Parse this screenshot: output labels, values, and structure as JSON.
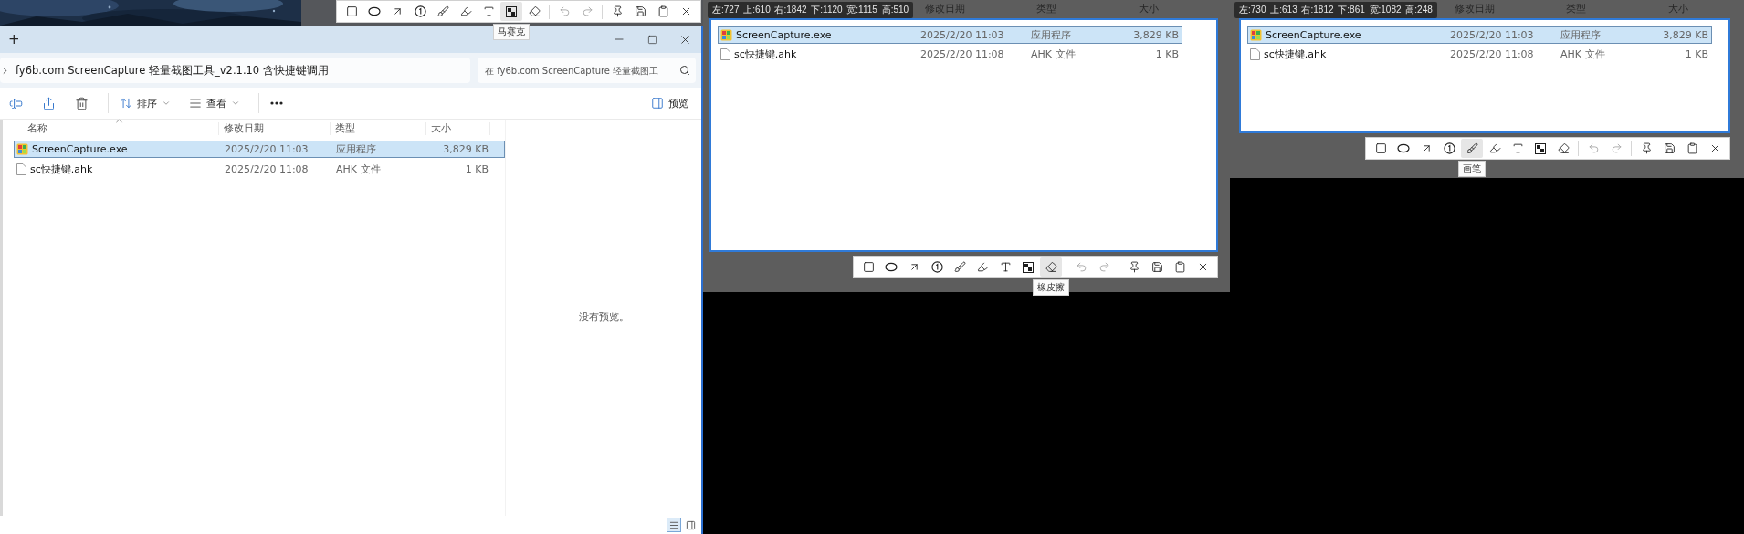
{
  "screen_toolbar": {
    "tooltip": "马赛克",
    "groups": [
      {
        "tools": [
          {
            "kind": "rectangle",
            "hovered": false,
            "disabled": false
          },
          {
            "kind": "ellipse",
            "hovered": false,
            "disabled": false
          },
          {
            "kind": "arrow",
            "hovered": false,
            "disabled": false
          },
          {
            "kind": "number",
            "hovered": false,
            "disabled": false
          },
          {
            "kind": "pen",
            "hovered": false,
            "disabled": false
          },
          {
            "kind": "highlighter",
            "hovered": false,
            "disabled": false
          },
          {
            "kind": "text",
            "hovered": false,
            "disabled": false
          },
          {
            "kind": "mosaic",
            "hovered": true,
            "disabled": false
          },
          {
            "kind": "eraser",
            "hovered": false,
            "disabled": false
          }
        ]
      },
      {
        "tools": [
          {
            "kind": "undo",
            "hovered": false,
            "disabled": true
          },
          {
            "kind": "redo",
            "hovered": false,
            "disabled": true
          }
        ]
      },
      {
        "tools": [
          {
            "kind": "pin",
            "hovered": false,
            "disabled": false
          },
          {
            "kind": "save",
            "hovered": false,
            "disabled": false
          },
          {
            "kind": "copy",
            "hovered": false,
            "disabled": false
          },
          {
            "kind": "close",
            "hovered": false,
            "disabled": false
          }
        ]
      }
    ]
  },
  "explorer": {
    "new_tab": "+",
    "address": "fy6b.com ScreenCapture 轻量截图工具_v2.1.10 含快捷键调用",
    "search_placeholder": "在 fy6b.com ScreenCapture 轻量截图工",
    "command_groups": [
      [
        {
          "kind": "rename"
        },
        {
          "kind": "share"
        },
        {
          "kind": "delete"
        }
      ],
      [
        {
          "kind": "sort",
          "label": "排序"
        },
        {
          "kind": "view",
          "label": "查看"
        }
      ],
      [
        {
          "kind": "more"
        }
      ]
    ],
    "preview_button": "预览",
    "columns": [
      "名称",
      "修改日期",
      "类型",
      "大小"
    ],
    "rows": [
      {
        "kind": "exe",
        "name": "ScreenCapture.exe",
        "date": "2025/2/20 11:03",
        "type": "应用程序",
        "size": "3,829 KB",
        "selected": true
      },
      {
        "kind": "file",
        "name": "sc快捷键.ahk",
        "date": "2025/2/20 11:08",
        "type": "AHK 文件",
        "size": "1 KB",
        "selected": false
      }
    ],
    "preview_message": "没有预览。",
    "view_buttons": [
      {
        "kind": "details",
        "selected": true
      },
      {
        "kind": "tiles",
        "selected": false
      }
    ]
  },
  "captures": [
    {
      "info": "左:727 上:610 右:1842 下:1120 宽:1115 高:510",
      "background_columns": [
        "修改日期",
        "类型",
        "大小"
      ],
      "rows": [
        {
          "kind": "exe",
          "name": "ScreenCapture.exe",
          "date": "2025/2/20 11:03",
          "type": "应用程序",
          "size": "3,829 KB",
          "selected": true
        },
        {
          "kind": "file",
          "name": "sc快捷键.ahk",
          "date": "2025/2/20 11:08",
          "type": "AHK 文件",
          "size": "1 KB",
          "selected": false
        }
      ],
      "toolbar": {
        "tooltip": "橡皮擦",
        "groups": [
          {
            "tools": [
              {
                "kind": "rectangle",
                "hovered": false,
                "disabled": false
              },
              {
                "kind": "ellipse",
                "hovered": false,
                "disabled": false
              },
              {
                "kind": "arrow",
                "hovered": false,
                "disabled": false
              },
              {
                "kind": "number",
                "hovered": false,
                "disabled": false
              },
              {
                "kind": "pen",
                "hovered": false,
                "disabled": false
              },
              {
                "kind": "highlighter",
                "hovered": false,
                "disabled": false
              },
              {
                "kind": "text",
                "hovered": false,
                "disabled": false
              },
              {
                "kind": "mosaic",
                "hovered": false,
                "disabled": false
              },
              {
                "kind": "eraser",
                "hovered": true,
                "disabled": false
              }
            ]
          },
          {
            "tools": [
              {
                "kind": "undo",
                "hovered": false,
                "disabled": true
              },
              {
                "kind": "redo",
                "hovered": false,
                "disabled": true
              }
            ]
          },
          {
            "tools": [
              {
                "kind": "pin",
                "hovered": false,
                "disabled": false
              },
              {
                "kind": "save",
                "hovered": false,
                "disabled": false
              },
              {
                "kind": "copy",
                "hovered": false,
                "disabled": false
              },
              {
                "kind": "close",
                "hovered": false,
                "disabled": false
              }
            ]
          }
        ]
      }
    },
    {
      "info": "左:730 上:613 右:1812 下:861 宽:1082 高:248",
      "background_columns": [
        "修改日期",
        "类型",
        "大小"
      ],
      "rows": [
        {
          "kind": "exe",
          "name": "ScreenCapture.exe",
          "date": "2025/2/20 11:03",
          "type": "应用程序",
          "size": "3,829 KB",
          "selected": true
        },
        {
          "kind": "file",
          "name": "sc快捷键.ahk",
          "date": "2025/2/20 11:08",
          "type": "AHK 文件",
          "size": "1 KB",
          "selected": false
        }
      ],
      "toolbar": {
        "tooltip": "画笔",
        "groups": [
          {
            "tools": [
              {
                "kind": "rectangle",
                "hovered": false,
                "disabled": false
              },
              {
                "kind": "ellipse",
                "hovered": false,
                "disabled": false
              },
              {
                "kind": "arrow",
                "hovered": false,
                "disabled": false
              },
              {
                "kind": "number",
                "hovered": false,
                "disabled": false
              },
              {
                "kind": "pen",
                "hovered": true,
                "disabled": false
              },
              {
                "kind": "highlighter",
                "hovered": false,
                "disabled": false
              },
              {
                "kind": "text",
                "hovered": false,
                "disabled": false
              },
              {
                "kind": "mosaic",
                "hovered": false,
                "disabled": false
              },
              {
                "kind": "eraser",
                "hovered": false,
                "disabled": false
              }
            ]
          },
          {
            "tools": [
              {
                "kind": "undo",
                "hovered": false,
                "disabled": true
              },
              {
                "kind": "redo",
                "hovered": false,
                "disabled": true
              }
            ]
          },
          {
            "tools": [
              {
                "kind": "pin",
                "hovered": false,
                "disabled": false
              },
              {
                "kind": "save",
                "hovered": false,
                "disabled": false
              },
              {
                "kind": "copy",
                "hovered": false,
                "disabled": false
              },
              {
                "kind": "close",
                "hovered": false,
                "disabled": false
              }
            ]
          }
        ]
      }
    }
  ]
}
